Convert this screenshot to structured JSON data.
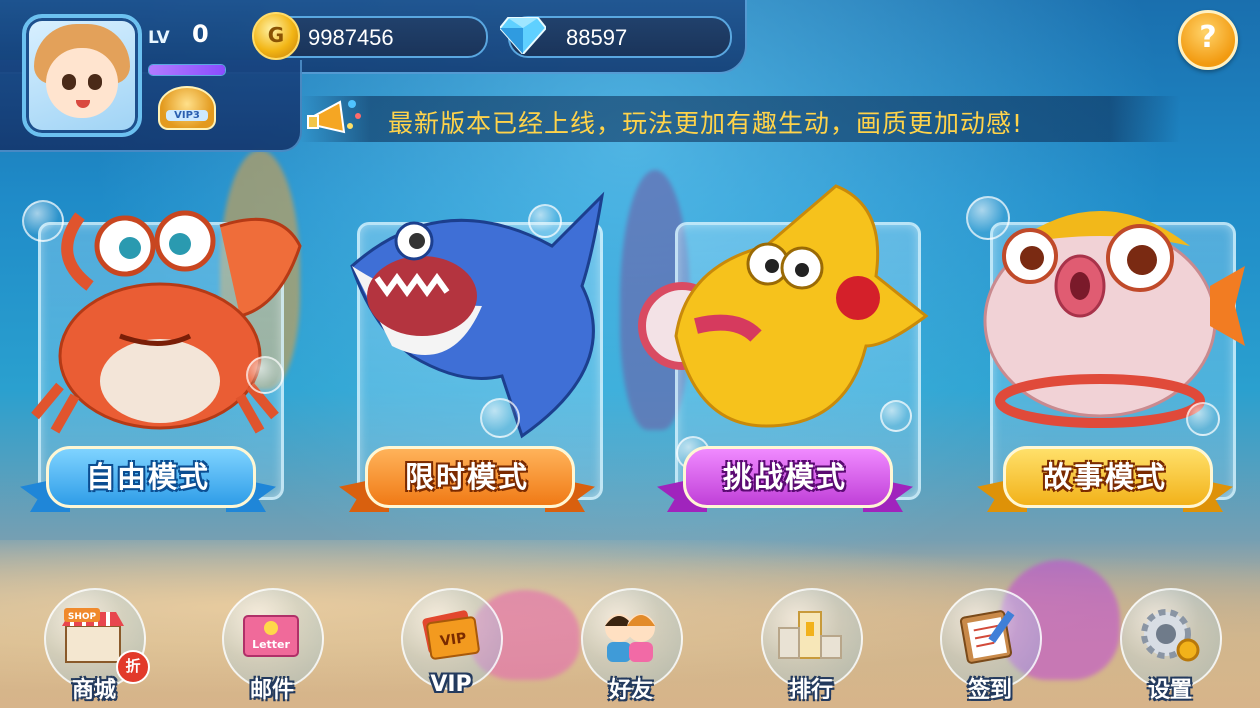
{
  "player": {
    "lv_label": "LV",
    "level": "0",
    "xp_progress": 1.0,
    "vip_label": "VIP3"
  },
  "currency": {
    "gold": "9987456",
    "diamonds": "88597",
    "coin_icon_letter": "G"
  },
  "help": {
    "label": "?"
  },
  "notice": {
    "text": "最新版本已经上线，玩法更加有趣生动，画质更加动感!"
  },
  "modes": [
    {
      "label": "自由模式",
      "creature": "crab",
      "color": "#2f9de8"
    },
    {
      "label": "限时模式",
      "creature": "shark",
      "color": "#f07a16"
    },
    {
      "label": "挑战模式",
      "creature": "yellow-fish",
      "color": "#c040d8"
    },
    {
      "label": "故事模式",
      "creature": "pufferfish",
      "color": "#f2b21a"
    }
  ],
  "dock": [
    {
      "label": "商城",
      "icon": "shop-icon",
      "sign": "SHOP",
      "badge": "折"
    },
    {
      "label": "邮件",
      "icon": "letter-icon",
      "sign": "Letter"
    },
    {
      "label": "VIP",
      "icon": "vip-ticket-icon",
      "sign": "VIP"
    },
    {
      "label": "好友",
      "icon": "friends-icon"
    },
    {
      "label": "排行",
      "icon": "podium-icon"
    },
    {
      "label": "签到",
      "icon": "checkin-clipboard-icon"
    },
    {
      "label": "设置",
      "icon": "settings-gear-icon"
    }
  ]
}
